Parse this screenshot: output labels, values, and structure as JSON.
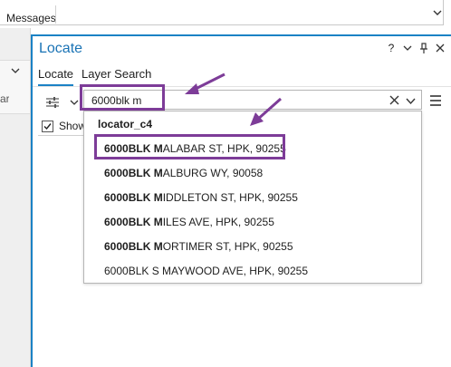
{
  "messages": {
    "label": "Messages"
  },
  "left_pane": {
    "partial_text": "ar"
  },
  "locate": {
    "title": "Locate",
    "tools": {
      "help": "?",
      "menu": "⌄",
      "pin": "⊥",
      "close": "×"
    },
    "tabs": [
      {
        "label": "Locate",
        "active": true
      },
      {
        "label": "Layer Search",
        "active": false
      }
    ],
    "search": {
      "value": "6000blk m"
    },
    "show_label": "Show",
    "dropdown": {
      "header": "locator_c4",
      "items": [
        {
          "bold": "6000BLK M",
          "rest": "ALABAR ST, HPK, 90255"
        },
        {
          "bold": "6000BLK M",
          "rest": "ALBURG WY, 90058"
        },
        {
          "bold": "6000BLK M",
          "rest": "IDDLETON ST, HPK, 90255"
        },
        {
          "bold": "6000BLK M",
          "rest": "ILES AVE, HPK, 90255"
        },
        {
          "bold": "6000BLK M",
          "rest": "ORTIMER ST, HPK, 90255"
        },
        {
          "bold": "",
          "rest": "6000BLK S MAYWOOD AVE, HPK, 90255"
        }
      ]
    }
  },
  "colors": {
    "accent": "#1b82c5",
    "annotation": "#7d3c98",
    "title": "#1a73b5"
  },
  "icons": [
    "chevron-down-icon",
    "settings-sliders-icon",
    "clear-icon",
    "hamburger-menu-icon",
    "checkbox-checked-icon",
    "pin-icon",
    "close-icon",
    "help-icon"
  ]
}
